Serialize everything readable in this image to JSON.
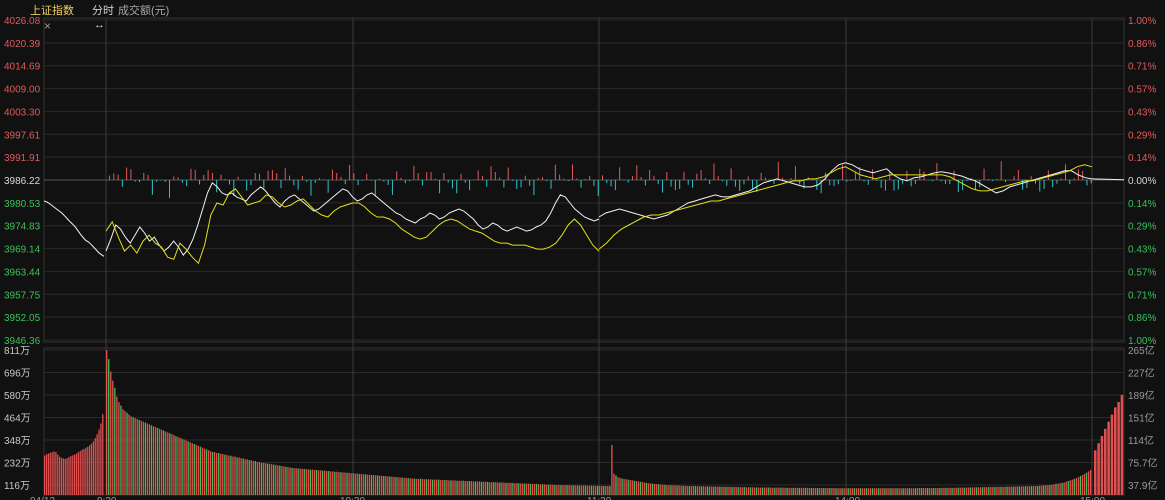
{
  "header": {
    "index_name": "上证指数",
    "tab_intraday": "分时",
    "volume_label": "成交额(元)",
    "close_glyph": "×",
    "drag_glyph": "↔"
  },
  "colors": {
    "background": "#111111",
    "grid": "#2a2a2a",
    "up": "#e25a5a",
    "down": "#2fc3c8",
    "price_line": "#f2f2f2",
    "avg_line": "#e4e01a",
    "up_text": "#e25a5a",
    "down_text": "#39c15b",
    "title": "#f0d060",
    "vol_up": "#e05050",
    "vol_down": "#3cc050"
  },
  "chart_data": [
    {
      "type": "line",
      "title": "上证指数 分时",
      "prev_close": 3986.22,
      "y_ticks_left": [
        "4026.08",
        "4020.39",
        "4014.69",
        "4009.00",
        "4003.30",
        "3997.61",
        "3991.91",
        "3986.22",
        "3980.53",
        "3974.83",
        "3969.14",
        "3963.44",
        "3957.75",
        "3952.05",
        "3946.36"
      ],
      "y_ticks_right": [
        "1.00%",
        "0.86%",
        "0.71%",
        "0.57%",
        "0.43%",
        "0.29%",
        "0.14%",
        "0.00%",
        "0.14%",
        "0.29%",
        "0.43%",
        "0.57%",
        "0.71%",
        "0.86%",
        "1.00%"
      ],
      "ylim": [
        3946.36,
        4026.08
      ],
      "x_ticks": [
        "04/12",
        "9:30",
        "10:30",
        "11:30",
        "14:00",
        "15:00"
      ],
      "previous_session_tail": [
        3981.0,
        3980.8,
        3980.4,
        3979.9,
        3979.4,
        3978.9,
        3978.4,
        3977.9,
        3977.2,
        3976.5,
        3975.8,
        3975.2,
        3974.5,
        3973.6,
        3972.7,
        3971.9,
        3971.2,
        3970.8,
        3970.2,
        3969.5,
        3968.8,
        3968.1,
        3967.6,
        3967.2
      ],
      "price_first_half": [
        3968.5,
        3971.5,
        3975.0,
        3974.0,
        3972.0,
        3970.5,
        3972.5,
        3974.5,
        3973.0,
        3971.0,
        3972.0,
        3970.0,
        3968.5,
        3969.5,
        3971.0,
        3969.5,
        3967.5,
        3969.0,
        3971.5,
        3975.0,
        3979.0,
        3983.0,
        3985.5,
        3984.5,
        3983.0,
        3982.5,
        3983.0,
        3982.0,
        3981.5,
        3981.0,
        3982.5,
        3983.5,
        3984.5,
        3983.5,
        3982.0,
        3980.5,
        3979.5,
        3981.0,
        3982.0,
        3982.5,
        3981.5,
        3980.5,
        3979.5,
        3978.5,
        3979.0,
        3980.0,
        3981.0,
        3982.0,
        3983.0,
        3984.0,
        3983.5,
        3982.0,
        3981.0,
        3981.5,
        3982.5,
        3983.0,
        3982.0,
        3981.0,
        3980.0,
        3979.0,
        3978.0,
        3977.5,
        3976.5,
        3976.0,
        3975.5,
        3976.5,
        3977.0,
        3978.0,
        3977.5,
        3976.5,
        3977.0,
        3978.0,
        3978.5,
        3979.0,
        3978.5,
        3977.5,
        3976.5,
        3975.0,
        3974.0,
        3974.5,
        3975.5,
        3975.0,
        3974.0,
        3973.5,
        3974.0,
        3974.5,
        3974.0,
        3973.5,
        3973.8,
        3974.5,
        3975.0,
        3976.0,
        3978.0,
        3980.5,
        3982.5,
        3982.0,
        3980.5,
        3979.0,
        3978.0,
        3977.0,
        3976.5,
        3976.0,
        3976.5
      ],
      "price_second_half": [
        3977.0,
        3978.0,
        3978.5,
        3979.0,
        3978.5,
        3978.0,
        3977.5,
        3977.0,
        3976.5,
        3977.0,
        3977.5,
        3978.5,
        3979.5,
        3980.5,
        3981.0,
        3981.5,
        3982.0,
        3982.5,
        3982.0,
        3982.0,
        3982.5,
        3983.0,
        3983.5,
        3984.5,
        3985.5,
        3986.0,
        3986.5,
        3986.0,
        3985.5,
        3985.0,
        3984.5,
        3984.5,
        3985.0,
        3986.5,
        3988.5,
        3990.0,
        3990.5,
        3990.0,
        3989.0,
        3988.5,
        3988.0,
        3988.5,
        3989.0,
        3987.5,
        3986.5,
        3986.0,
        3986.8,
        3987.0,
        3987.5,
        3988.0,
        3988.3,
        3988.0,
        3987.6,
        3987.2,
        3986.5,
        3986.0,
        3985.0,
        3984.0,
        3983.0,
        3983.5,
        3984.5,
        3985.0,
        3985.5,
        3986.0,
        3986.5,
        3987.0,
        3987.5,
        3988.0,
        3988.5,
        3988.5,
        3987.5,
        3986.8,
        3986.5
      ],
      "avg_first_half": [
        3973.5,
        3975.8,
        3972.0,
        3968.5,
        3970.0,
        3968.0,
        3971.0,
        3972.5,
        3970.5,
        3969.5,
        3967.0,
        3966.5,
        3970.5,
        3969.0,
        3967.0,
        3965.5,
        3970.0,
        3977.5,
        3980.5,
        3980.0,
        3983.0,
        3984.0,
        3982.0,
        3980.0,
        3980.5,
        3981.0,
        3982.5,
        3982.0,
        3980.5,
        3979.5,
        3980.0,
        3981.0,
        3981.5,
        3980.0,
        3978.5,
        3977.5,
        3977.0,
        3978.5,
        3979.5,
        3980.0,
        3980.5,
        3980.5,
        3979.5,
        3978.0,
        3977.0,
        3977.0,
        3976.5,
        3975.5,
        3974.0,
        3973.0,
        3972.0,
        3971.5,
        3972.0,
        3973.5,
        3975.0,
        3976.0,
        3976.5,
        3976.0,
        3975.0,
        3974.0,
        3973.5,
        3973.0,
        3972.0,
        3971.0,
        3970.5,
        3970.5,
        3970.0,
        3970.0,
        3970.0,
        3969.5,
        3969.0,
        3969.0,
        3969.5,
        3970.5,
        3972.5,
        3975.0,
        3976.5,
        3975.0,
        3972.5,
        3970.0,
        3968.5
      ],
      "avg_second_half": [
        3969.0,
        3970.5,
        3972.5,
        3974.0,
        3975.0,
        3976.0,
        3977.0,
        3977.5,
        3977.5,
        3978.0,
        3978.5,
        3979.0,
        3979.5,
        3980.0,
        3980.5,
        3981.0,
        3981.0,
        3981.5,
        3982.0,
        3982.5,
        3983.0,
        3983.5,
        3984.0,
        3984.5,
        3985.0,
        3985.5,
        3986.0,
        3986.0,
        3986.5,
        3986.5,
        3987.0,
        3988.0,
        3989.0,
        3989.5,
        3988.5,
        3987.5,
        3987.0,
        3986.5,
        3987.0,
        3987.5,
        3987.5,
        3987.5,
        3987.5,
        3987.5,
        3987.5,
        3987.5,
        3987.5,
        3987.0,
        3986.0,
        3985.0,
        3984.0,
        3983.5,
        3983.5,
        3984.0,
        3984.5,
        3985.0,
        3985.5,
        3986.0,
        3986.0,
        3986.5,
        3987.0,
        3987.5,
        3988.0,
        3988.5,
        3989.5,
        3990.0,
        3989.5
      ]
    },
    {
      "type": "bar",
      "title": "成交额(元)",
      "y_ticks_left": [
        "811万",
        "696万",
        "580万",
        "464万",
        "348万",
        "232万",
        "116万"
      ],
      "y_ticks_right": [
        "265亿",
        "227亿",
        "189亿",
        "151亿",
        "114亿",
        "75.7亿",
        "37.9亿"
      ],
      "ylim": [
        0,
        811
      ],
      "unit": "万",
      "bars_prev_session": [
        220,
        228,
        232,
        236,
        240,
        244,
        240,
        226,
        214,
        208,
        204,
        202,
        206,
        212,
        218,
        222,
        226,
        232,
        238,
        246,
        254,
        258,
        264,
        270,
        278,
        288,
        300,
        318,
        340,
        366,
        400,
        452
      ],
      "bars_trading": [
        810,
        760,
        690,
        640,
        600,
        550,
        520,
        500,
        480,
        470,
        460,
        450,
        440,
        435,
        430,
        425,
        420,
        415,
        410,
        405,
        400,
        395,
        390,
        385,
        380,
        375,
        370,
        365,
        360,
        355,
        350,
        345,
        340,
        335,
        330,
        325,
        320,
        315,
        310,
        305,
        300,
        295,
        290,
        285,
        280,
        275,
        270,
        265,
        260,
        255,
        250,
        245,
        240,
        240,
        235,
        235,
        230,
        230,
        225,
        225,
        220,
        220,
        215,
        215,
        210,
        210,
        205,
        205,
        200,
        200,
        195,
        195,
        190,
        190,
        185,
        185,
        180,
        180,
        178,
        176,
        174,
        172,
        170,
        168,
        166,
        164,
        162,
        160,
        158,
        156,
        154,
        152,
        150,
        150,
        148,
        148,
        146,
        146,
        144,
        144,
        142,
        142,
        140,
        140,
        138,
        138,
        136,
        136,
        134,
        134,
        132,
        132,
        130,
        130,
        128,
        128,
        126,
        126,
        124,
        124,
        122,
        122,
        120,
        120,
        118,
        118,
        116,
        116,
        114,
        114,
        112,
        112,
        110,
        110,
        108,
        108,
        106,
        106,
        104,
        104,
        102,
        102,
        100,
        100,
        98,
        98,
        96,
        96,
        94,
        94,
        92,
        92,
        90,
        90,
        90,
        90,
        88,
        88,
        88,
        88,
        86,
        86,
        86,
        86,
        84,
        84,
        84,
        84,
        82,
        82,
        82,
        82,
        80,
        80,
        80,
        80,
        78,
        78,
        78,
        78,
        76,
        76,
        76,
        76,
        74,
        74,
        74,
        74,
        72,
        72,
        72,
        72,
        70,
        70,
        70,
        70,
        68,
        68,
        68,
        68,
        66,
        66,
        66,
        66,
        64,
        64,
        64,
        64,
        62,
        62,
        62,
        62,
        60,
        60,
        60,
        60,
        58,
        58,
        58,
        58,
        56,
        56,
        56,
        56,
        55,
        55,
        55,
        55,
        54,
        54,
        54,
        54,
        53,
        53,
        53,
        53,
        52,
        52,
        52,
        52,
        51,
        51,
        51,
        51,
        50,
        50,
        50,
        50,
        280,
        120,
        110,
        100,
        96,
        92,
        90,
        88,
        86,
        84,
        82,
        80,
        78,
        76,
        74,
        72,
        70,
        68,
        66,
        64,
        63,
        62,
        61,
        60,
        59,
        58,
        57,
        56,
        55,
        55,
        54,
        54,
        53,
        53,
        52,
        52,
        51,
        51,
        50,
        50,
        50,
        50,
        49,
        49,
        49,
        49,
        48,
        48,
        48,
        48,
        47,
        47,
        47,
        47,
        46,
        46,
        46,
        46,
        45,
        45,
        45,
        45,
        44,
        44,
        44,
        44,
        43,
        43,
        43,
        43,
        42,
        42,
        42,
        42,
        42,
        42,
        42,
        42,
        41,
        41,
        41,
        41,
        41,
        41,
        41,
        41,
        40,
        40,
        40,
        40,
        40,
        40,
        40,
        40,
        40,
        40,
        40,
        40,
        39,
        39,
        39,
        39,
        39,
        39,
        39,
        39,
        39,
        39,
        39,
        39,
        38,
        38,
        38,
        38,
        38,
        38,
        38,
        38,
        38,
        38,
        38,
        38,
        38,
        38,
        38,
        38,
        38,
        38,
        38,
        38,
        38,
        38,
        38,
        38,
        38,
        38,
        38,
        38,
        38,
        38,
        38,
        38,
        38,
        38,
        38,
        38,
        38,
        38,
        38,
        38,
        39,
        39,
        39,
        39,
        39,
        39,
        39,
        39,
        39,
        39,
        39,
        39,
        40,
        40,
        40,
        40,
        40,
        40,
        40,
        40,
        41,
        41,
        41,
        41,
        42,
        42,
        42,
        42,
        43,
        43,
        43,
        43,
        44,
        44,
        44,
        44,
        45,
        45,
        45,
        45,
        46,
        46,
        46,
        46,
        47,
        47,
        47,
        47,
        48,
        48,
        48,
        48,
        49,
        49,
        49,
        49,
        50,
        50,
        50,
        50,
        52,
        52,
        54,
        54,
        56,
        56,
        58,
        60,
        62,
        64,
        66,
        68,
        70,
        74,
        78,
        82,
        86,
        90,
        95,
        100,
        106,
        112,
        118,
        125,
        132,
        140
      ],
      "bars_after_close": [
        250,
        290,
        330,
        370,
        410,
        450,
        490,
        520,
        560
      ]
    }
  ]
}
